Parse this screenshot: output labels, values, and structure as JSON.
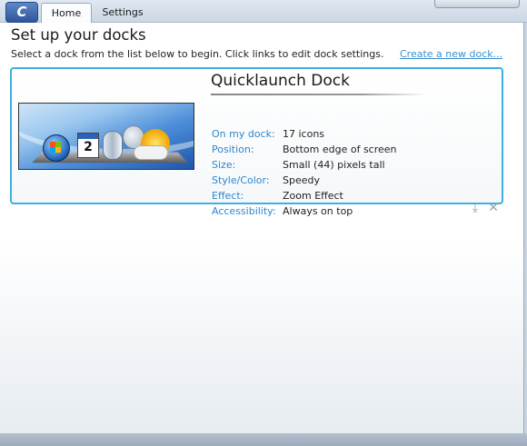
{
  "app": {
    "logo_text": "C"
  },
  "tabs": [
    {
      "label": "Home",
      "selected": true
    },
    {
      "label": "Settings",
      "selected": false
    }
  ],
  "main": {
    "title": "Set up your docks",
    "instructions": "Select a dock from the list below to begin. Click links to edit dock settings.",
    "create_link": "Create a new dock..."
  },
  "dock": {
    "name": "Quicklaunch Dock",
    "preview_icons": [
      "windows-start-orb",
      "calendar",
      "cd-drive",
      "globe",
      "weather"
    ],
    "preview_calendar_day": "2",
    "properties": [
      {
        "label": "On my dock:",
        "value": "17 icons"
      },
      {
        "label": "Position:",
        "value": "Bottom edge of screen"
      },
      {
        "label": "Size:",
        "value": "Small (44) pixels tall"
      },
      {
        "label": "Style/Color:",
        "value": "Speedy"
      },
      {
        "label": "Effect:",
        "value": "Zoom Effect"
      },
      {
        "label": "Accessibility:",
        "value": "Always on top"
      }
    ],
    "actions": {
      "export_icon": "export-icon",
      "delete_icon": "delete-icon"
    }
  },
  "colors": {
    "accent_border": "#3fb0de",
    "link": "#3a8fd0",
    "property_label": "#2f86cc"
  }
}
